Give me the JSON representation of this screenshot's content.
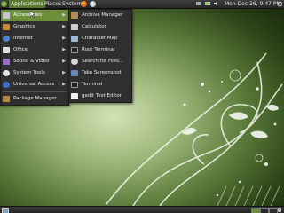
{
  "top_panel": {
    "menus": [
      "Applications",
      "Places",
      "System"
    ],
    "clock": "Mon Dec 26,  9:47 PM"
  },
  "applications_menu": {
    "items": [
      {
        "label": "Accessories",
        "icon": "accessories-icon",
        "submenu": true
      },
      {
        "label": "Graphics",
        "icon": "graphics-icon",
        "submenu": true
      },
      {
        "label": "Internet",
        "icon": "internet-icon",
        "submenu": true
      },
      {
        "label": "Office",
        "icon": "office-icon",
        "submenu": true
      },
      {
        "label": "Sound & Video",
        "icon": "sound-video-icon",
        "submenu": true
      },
      {
        "label": "System Tools",
        "icon": "system-tools-icon",
        "submenu": true
      },
      {
        "label": "Universal Access",
        "icon": "universal-access-icon",
        "submenu": true
      },
      {
        "label": "Package Manager",
        "icon": "package-manager-icon",
        "submenu": false
      }
    ]
  },
  "accessories_menu": {
    "items": [
      {
        "label": "Archive Manager",
        "icon": "archive-manager-icon"
      },
      {
        "label": "Calculator",
        "icon": "calculator-icon"
      },
      {
        "label": "Character Map",
        "icon": "character-map-icon"
      },
      {
        "label": "Root Terminal",
        "icon": "root-terminal-icon"
      },
      {
        "label": "Search for Files...",
        "icon": "search-files-icon"
      },
      {
        "label": "Take Screenshot",
        "icon": "screenshot-icon"
      },
      {
        "label": "Terminal",
        "icon": "terminal-icon"
      },
      {
        "label": "gedit Text Editor",
        "icon": "text-editor-icon"
      }
    ]
  },
  "colors": {
    "highlight": "#6e8f3b",
    "menu_bg": "#2f2f2f",
    "panel_bg": "#2c2c2c"
  }
}
